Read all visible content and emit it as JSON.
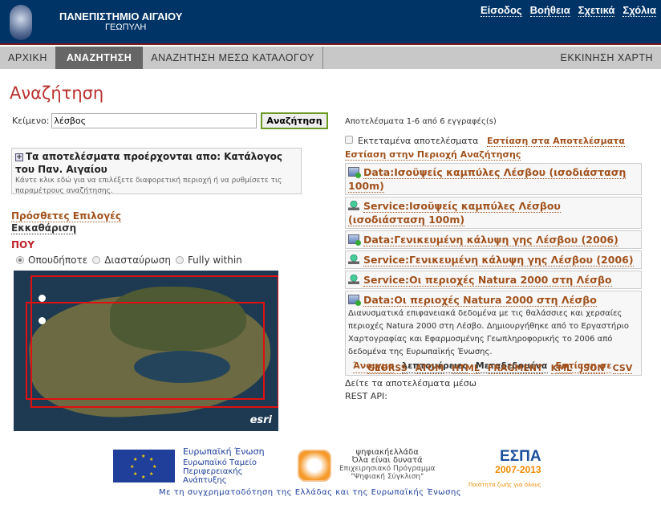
{
  "header": {
    "title": "ΠΑΝΕΠΙΣΤΗΜΙΟ ΑΙΓΑΙΟΥ",
    "subtitle": "ΓΕΩΠΥΛΗ",
    "links": [
      "Είσοδος",
      "Βοήθεια",
      "Σχετικά",
      "Σχόλια"
    ]
  },
  "nav": {
    "tabs": [
      "ΑΡΧΙΚΗ",
      "ΑΝΑΖΗΤΗΣΗ",
      "ΑΝΑΖΗΤΗΣΗ ΜΕΣΩ ΚΑΤΑΛΟΓΟΥ"
    ],
    "active": "ΑΝΑΖΗΤΗΣΗ",
    "right": "ΕΚΚΙΝΗΣΗ ΧΑΡΤΗ"
  },
  "page_title": "Αναζήτηση",
  "search": {
    "label": "Κείμενο:",
    "value": "λέσβος",
    "button": "Αναζήτηση"
  },
  "catalog": {
    "title": "Τα αποτελέσματα προέρχονται απο: Κατάλογος του Παν. Αιγαίου",
    "hint": "Κάντε κλικ εδώ για να επιλέξετε διαφορετική περιοχή ή να ρυθμίσετε τις παραμέτρους αναζήτησης."
  },
  "options": {
    "more": "Πρόσθετες Επιλογές",
    "clear": "Εκκαθάριση",
    "where": "ΠΟΥ",
    "radios": [
      "Οπουδήποτε",
      "Διασταύρωση",
      "Fully within"
    ],
    "selected": "Οπουδήποτε"
  },
  "map": {
    "attribution": "esri"
  },
  "results": {
    "count": "Αποτελέσματα 1-6 από 6 εγγραφές(s)",
    "extended": "Εκτεταμένα αποτελέσματα",
    "extended_checked": false,
    "zoom_results": "Εστίαση στα Αποτελέσματα",
    "zoom_area": "Εστίαση στην Περιοχή Αναζήτησης",
    "items": [
      {
        "type": "data",
        "title": "Data:Ισοϋψείς καμπύλες Λέσβου (ισοδιάσταση 100m)"
      },
      {
        "type": "service",
        "title": "Service:Ισοϋψείς καμπύλες Λέσβου (ισοδιάσταση 100m)"
      },
      {
        "type": "data",
        "title": "Data:Γενικευμένη κάλυψη γης Λέσβου (2006)"
      },
      {
        "type": "service",
        "title": "Service:Γενικευμένη κάλυψη γης Λέσβου (2006)"
      },
      {
        "type": "service",
        "title": "Service:Οι περιοχές Natura 2000 στη Λέσβο"
      },
      {
        "type": "data",
        "title": "Data:Οι περιοχές Natura 2000 στη Λέσβο",
        "description": "Διανυσματικά επιφανειακά δεδομένα με τις θαλάσσιες και χερσαίες περιοχές Natura 2000 στη Λέσβο. Δημιουργήθηκε από το Εργαστήριο Χαρτογραφίας και Εφαρμοσμένης Γεωπληροφορικής το 2006 από δεδομένα της Ευρωπαϊκής Ένωσης.",
        "actions": [
          "Άνοιγμα",
          "λεπτομέρειες",
          "Μεταδεδομένα",
          "Εστίαση σε"
        ]
      }
    ],
    "rest_text": "Δείτε τα αποτελέσματα μέσω REST API:",
    "api": [
      "GEORSS",
      "ATOM",
      "HTML",
      "FRAGMENT",
      "KML",
      "JSON",
      "CSV"
    ]
  },
  "footer": {
    "eu": {
      "title": "Ευρωπαϊκή Ένωση",
      "lines": [
        "Ευρωπαϊκό Ταμείο",
        "Περιφερειακής",
        "Ανάπτυξης"
      ]
    },
    "digital": {
      "name": "ψηφιακήελλάδα",
      "slogan": "Όλα είναι δυνατά",
      "program": "Επιχειρησιακό Πρόγραμμα",
      "subprogram": "\"Ψηφιακή Σύγκλιση\""
    },
    "espa": {
      "name": "ΕΣΠΑ",
      "years": "2007-2013",
      "tagline": "Ποιότητα ζωής για όλους"
    },
    "cofund": "Με τη συγχρηματοδότηση της Ελλάδας και της Ευρωπαϊκής Ένωσης"
  }
}
